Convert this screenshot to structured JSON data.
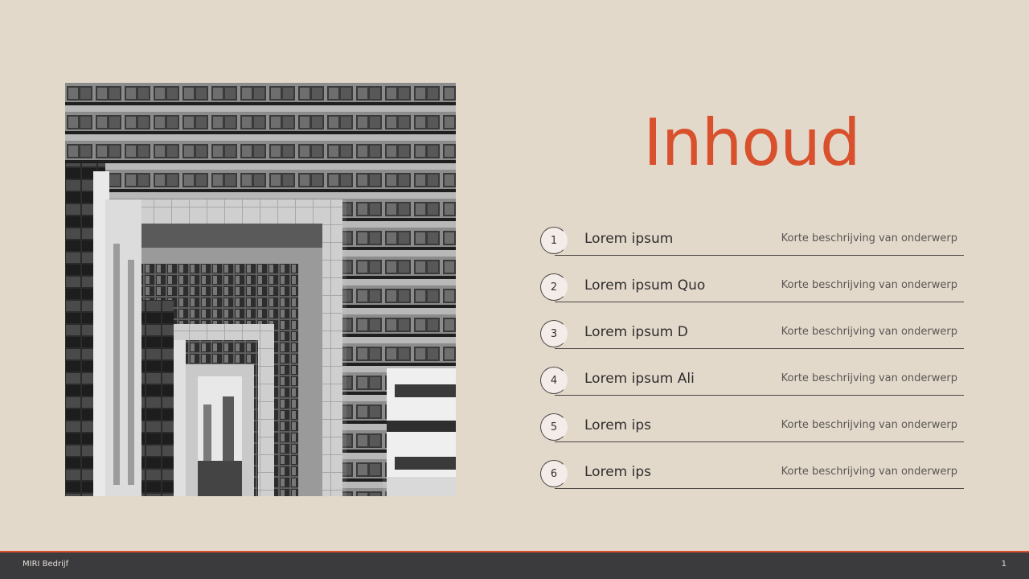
{
  "slide": {
    "title": "Inhoud",
    "photo_icon": "building-photo"
  },
  "agenda": {
    "items": [
      {
        "number": "1",
        "label": "Lorem ipsum",
        "description": "Korte beschrijving van onderwerp"
      },
      {
        "number": "2",
        "label": "Lorem ipsum Quo",
        "description": "Korte beschrijving van onderwerp"
      },
      {
        "number": "3",
        "label": "Lorem ipsum D",
        "description": "Korte beschrijving van onderwerp"
      },
      {
        "number": "4",
        "label": "Lorem ipsum Ali",
        "description": "Korte beschrijving van onderwerp"
      },
      {
        "number": "5",
        "label": "Lorem ips",
        "description": "Korte beschrijving van onderwerp"
      },
      {
        "number": "6",
        "label": "Lorem ips",
        "description": "Korte beschrijving van onderwerp"
      }
    ]
  },
  "footer": {
    "company": "MIRI Bedrijf",
    "page_number": "1"
  },
  "colors": {
    "background": "#e3d9cb",
    "accent": "#d9502d",
    "footer": "#3b3a3c"
  }
}
